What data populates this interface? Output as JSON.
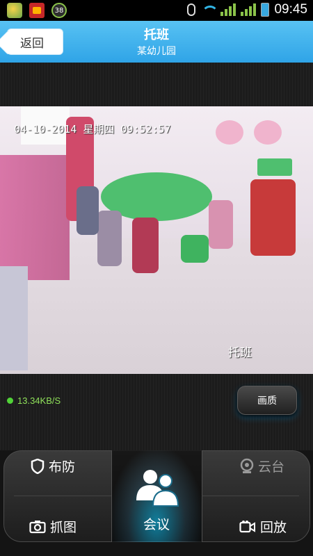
{
  "status_bar": {
    "time": "09:45",
    "notification_badge": "38",
    "colors": {
      "wifi": "#32b5e5",
      "signal": "#8bc34a",
      "battery": "#39a9e0"
    }
  },
  "header": {
    "back_label": "返回",
    "title": "托班",
    "subtitle": "某幼儿园",
    "accent_color": "#2fa4e7"
  },
  "video": {
    "timestamp": "04-10-2014 星期四 09:52:57",
    "caption": "托班"
  },
  "stream": {
    "speed": "13.34KB/S",
    "quality_label": "画质"
  },
  "controls": {
    "arm": "布防",
    "ptz": "云台",
    "snapshot": "抓图",
    "meeting": "会议",
    "playback": "回放"
  }
}
